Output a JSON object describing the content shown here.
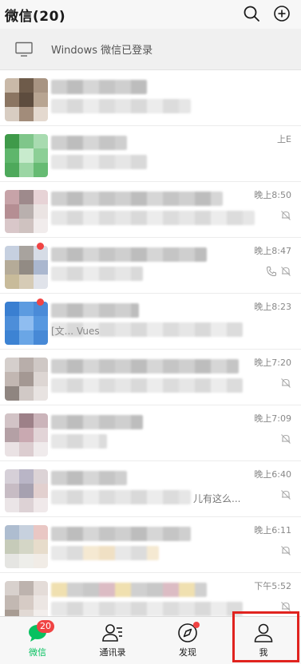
{
  "header": {
    "title": "微信(20)",
    "search_icon": "search-icon",
    "add_icon": "plus-circle-icon"
  },
  "login_bar": {
    "icon": "desktop-icon",
    "text": "Windows 微信已登录"
  },
  "chats": [
    {
      "time": "",
      "snippet": "",
      "muted": false
    },
    {
      "time": "上Ε",
      "snippet": "",
      "muted": false
    },
    {
      "time": "晚上8:50",
      "snippet": "",
      "muted": true
    },
    {
      "time": "晚上8:47",
      "snippet": "",
      "muted": true,
      "call": true
    },
    {
      "time": "晚上8:23",
      "snippet": "[文... Vues",
      "muted": false
    },
    {
      "time": "晚上7:20",
      "snippet": "",
      "muted": true
    },
    {
      "time": "晚上7:09",
      "snippet": "",
      "muted": true
    },
    {
      "time": "晚上6:40",
      "snippet": "儿有这么...",
      "muted": true
    },
    {
      "time": "晚上6:11",
      "snippet": "",
      "muted": true
    },
    {
      "time": "下午5:52",
      "snippet": "",
      "muted": true
    }
  ],
  "tabbar": {
    "tabs": [
      {
        "label": "微信",
        "icon": "chat-bubble-icon",
        "badge": "20",
        "active": true
      },
      {
        "label": "通讯录",
        "icon": "contacts-icon",
        "active": false
      },
      {
        "label": "发现",
        "icon": "compass-icon",
        "dot": true,
        "active": false
      },
      {
        "label": "我",
        "icon": "person-icon",
        "active": false
      }
    ]
  },
  "colors": {
    "accent": "#07c160",
    "badge": "#f04444",
    "highlight": "#e0231f"
  }
}
